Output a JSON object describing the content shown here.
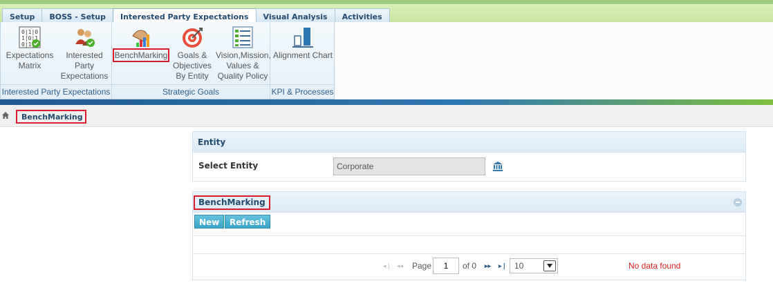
{
  "tabs": [
    {
      "label": "Setup"
    },
    {
      "label": "BOSS - Setup"
    },
    {
      "label": "Interested Party Expectations"
    },
    {
      "label": "Visual Analysis"
    },
    {
      "label": "Activities"
    }
  ],
  "ribbon": {
    "groups": [
      {
        "label": "Interested Party Expectations"
      },
      {
        "label": "Strategic Goals"
      },
      {
        "label": "KPI & Processes"
      }
    ],
    "items": {
      "expectations_matrix": {
        "line1": "Expectations",
        "line2": "Matrix",
        "icon": "matrix-icon"
      },
      "interested_party": {
        "line1": "Interested",
        "line2": "Party",
        "line3": "Expectations",
        "icon": "people-icon"
      },
      "benchmarking": {
        "line1": "BenchMarking",
        "icon": "handshake-chart-icon"
      },
      "goals": {
        "line1": "Goals &",
        "line2": "Objectives",
        "line3": "By Entity",
        "icon": "target-icon"
      },
      "vision": {
        "line1": "Vision,Mission,",
        "line2": "Values &",
        "line3": "Quality Policy",
        "icon": "checklist-icon"
      },
      "alignment": {
        "line1": "Alignment Chart",
        "icon": "bar-chart-icon"
      }
    }
  },
  "breadcrumb": {
    "label": "BenchMarking"
  },
  "entity_panel": {
    "title": "Entity",
    "select_label": "Select Entity",
    "select_value": "Corporate"
  },
  "bench_panel": {
    "title": "BenchMarking",
    "new_label": "New",
    "refresh_label": "Refresh"
  },
  "pager": {
    "first": "◂❘",
    "prev": "◂◂",
    "page_label": "Page",
    "page_value": "1",
    "of_label": "of 0",
    "next": "▸▸",
    "last": "▸❘",
    "page_size": "10",
    "status": "No data found"
  },
  "colors": {
    "accent": "#234a6e",
    "highlight": "#d81b2a",
    "button": "#3aa3c8",
    "error": "#e02020"
  }
}
